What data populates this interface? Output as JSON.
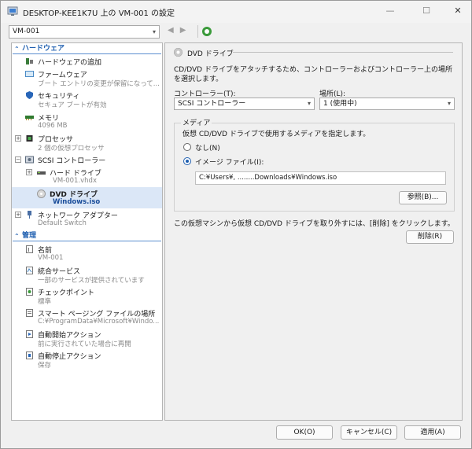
{
  "window": {
    "title": "DESKTOP-KEE1K7U 上の VM-001 の設定",
    "min_glyph": "—",
    "max_glyph": "☐",
    "close_glyph": "✕"
  },
  "toolbar": {
    "vm_selected": "VM-001",
    "back_glyph": "◀",
    "forward_glyph": "▶"
  },
  "tree": {
    "hardware_header": "ハードウェア",
    "management_header": "管理",
    "items": {
      "add_hardware": {
        "label": "ハードウェアの追加"
      },
      "firmware": {
        "label": "ファームウェア",
        "sub": "ブート エントリの変更が保留になって..."
      },
      "security": {
        "label": "セキュリティ",
        "sub": "セキュア ブートが有効"
      },
      "memory": {
        "label": "メモリ",
        "sub": "4096 MB"
      },
      "processor": {
        "label": "プロセッサ",
        "sub": "2 個の仮想プロセッサ"
      },
      "scsi": {
        "label": "SCSI コントローラー"
      },
      "hard_drive": {
        "label": "ハード ドライブ",
        "sub": "VM-001.vhdx"
      },
      "dvd_drive": {
        "label": "DVD ドライブ",
        "sub": "Windows.iso"
      },
      "network": {
        "label": "ネットワーク アダプター",
        "sub": "Default Switch"
      },
      "name": {
        "label": "名前",
        "sub": "VM-001"
      },
      "integration": {
        "label": "統合サービス",
        "sub": "一部のサービスが提供されています"
      },
      "checkpoint": {
        "label": "チェックポイント",
        "sub": "標準"
      },
      "smart_paging": {
        "label": "スマート ページング ファイルの場所",
        "sub": "C:¥ProgramData¥Microsoft¥Windo..."
      },
      "auto_start": {
        "label": "自動開始アクション",
        "sub": "前に実行されていた場合に再開"
      },
      "auto_stop": {
        "label": "自動停止アクション",
        "sub": "保存"
      }
    }
  },
  "panel": {
    "header": "DVD ドライブ",
    "description": "CD/DVD ドライブをアタッチするため、コントローラーおよびコントローラー上の場所を選択します。",
    "controller_label": "コントローラー(T):",
    "controller_value": "SCSI コントローラー",
    "location_label": "場所(L):",
    "location_value": "1 (使用中)",
    "media_legend": "メディア",
    "media_instruction": "仮想 CD/DVD ドライブで使用するメディアを指定します。",
    "none_option": "なし(N)",
    "image_option": "イメージ ファイル(I):",
    "image_path": "C:¥Users¥, ........Downloads¥Windows.iso",
    "browse_button": "参照(B)...",
    "remove_description": "この仮想マシンから仮想 CD/DVD ドライブを取り外すには、[削除] をクリックします。",
    "remove_button": "削除(R)"
  },
  "footer": {
    "ok": "OK(O)",
    "cancel": "キャンセル(C)",
    "apply": "適用(A)"
  }
}
